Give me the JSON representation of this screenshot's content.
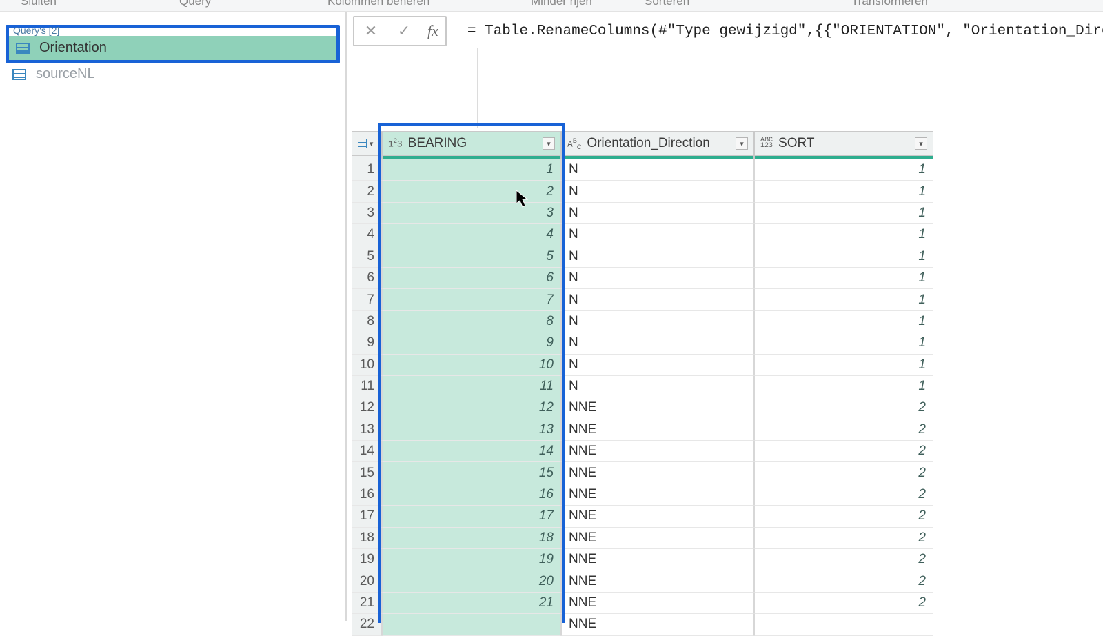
{
  "ribbon": {
    "close": "Sluiten",
    "query": "Query",
    "cols": "Kolommen beheren",
    "rows": "Minder rijen",
    "sort": "Sorteren",
    "transform": "Transformeren"
  },
  "queries": {
    "title": "Query's [2]",
    "items": [
      {
        "label": "Orientation"
      },
      {
        "label": "sourceNL"
      }
    ]
  },
  "formula": {
    "fx": "fx",
    "text": "= Table.RenameColumns(#\"Type gewijzigd\",{{\"ORIENTATION\", \"Orientation_Direction\"}})"
  },
  "columns": {
    "bearing": {
      "type": "1²3",
      "label": "BEARING"
    },
    "direction": {
      "type": "AᴮC",
      "label": "Orientation_Direction"
    },
    "sort": {
      "type": "ABC\n123",
      "label": "SORT"
    }
  },
  "rows": [
    {
      "n": "1",
      "bearing": "1",
      "dir": "N",
      "sort": "1"
    },
    {
      "n": "2",
      "bearing": "2",
      "dir": "N",
      "sort": "1"
    },
    {
      "n": "3",
      "bearing": "3",
      "dir": "N",
      "sort": "1"
    },
    {
      "n": "4",
      "bearing": "4",
      "dir": "N",
      "sort": "1"
    },
    {
      "n": "5",
      "bearing": "5",
      "dir": "N",
      "sort": "1"
    },
    {
      "n": "6",
      "bearing": "6",
      "dir": "N",
      "sort": "1"
    },
    {
      "n": "7",
      "bearing": "7",
      "dir": "N",
      "sort": "1"
    },
    {
      "n": "8",
      "bearing": "8",
      "dir": "N",
      "sort": "1"
    },
    {
      "n": "9",
      "bearing": "9",
      "dir": "N",
      "sort": "1"
    },
    {
      "n": "10",
      "bearing": "10",
      "dir": "N",
      "sort": "1"
    },
    {
      "n": "11",
      "bearing": "11",
      "dir": "N",
      "sort": "1"
    },
    {
      "n": "12",
      "bearing": "12",
      "dir": "NNE",
      "sort": "2"
    },
    {
      "n": "13",
      "bearing": "13",
      "dir": "NNE",
      "sort": "2"
    },
    {
      "n": "14",
      "bearing": "14",
      "dir": "NNE",
      "sort": "2"
    },
    {
      "n": "15",
      "bearing": "15",
      "dir": "NNE",
      "sort": "2"
    },
    {
      "n": "16",
      "bearing": "16",
      "dir": "NNE",
      "sort": "2"
    },
    {
      "n": "17",
      "bearing": "17",
      "dir": "NNE",
      "sort": "2"
    },
    {
      "n": "18",
      "bearing": "18",
      "dir": "NNE",
      "sort": "2"
    },
    {
      "n": "19",
      "bearing": "19",
      "dir": "NNE",
      "sort": "2"
    },
    {
      "n": "20",
      "bearing": "20",
      "dir": "NNE",
      "sort": "2"
    },
    {
      "n": "21",
      "bearing": "21",
      "dir": "NNE",
      "sort": "2"
    },
    {
      "n": "22",
      "bearing": "",
      "dir": "NNE",
      "sort": ""
    }
  ]
}
